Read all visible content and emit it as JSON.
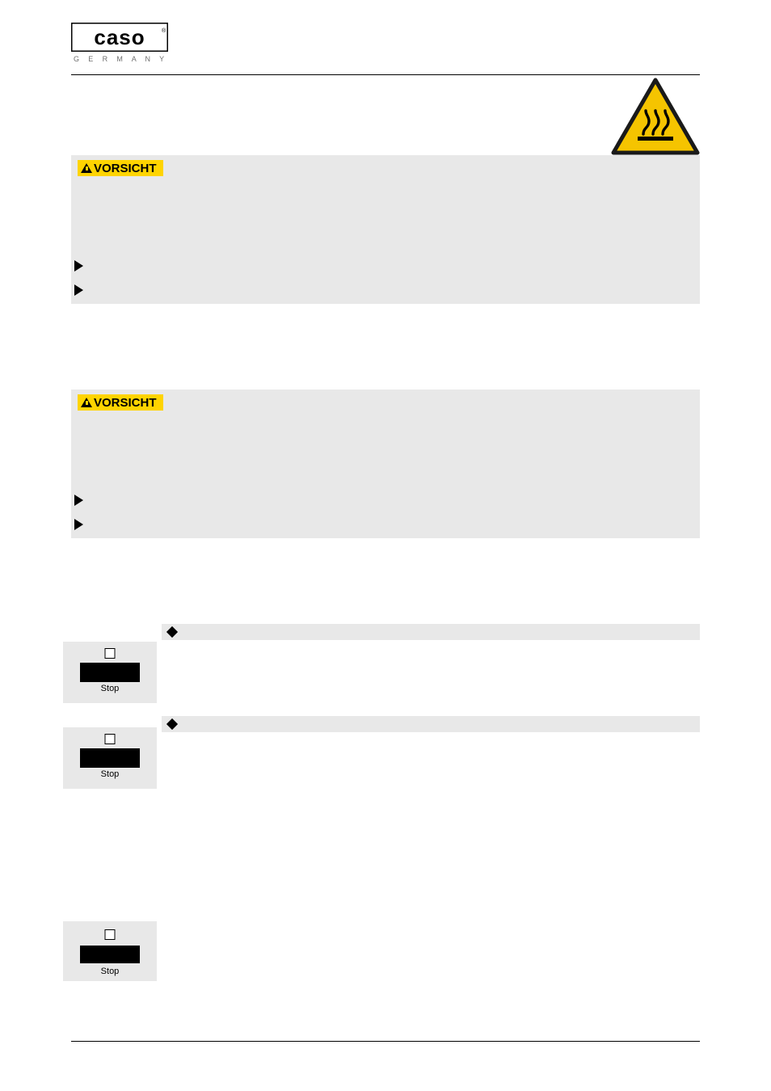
{
  "header": {
    "brand": "CASO",
    "brand_sub": "G E R M A N Y",
    "logo_icon": "caso-logo",
    "hot_surface_icon": "hot-surface-warning-triangle"
  },
  "cautions": [
    {
      "label": "VORSICHT",
      "warning_icon": "warning-triangle-icon",
      "body": "",
      "bullets": [
        "",
        ""
      ]
    },
    {
      "label": "VORSICHT",
      "warning_icon": "warning-triangle-icon",
      "body": "",
      "bullets": [
        "",
        ""
      ]
    }
  ],
  "steps": [
    {
      "panel": {
        "led_icon": "indicator-led",
        "key_label": "Stop"
      },
      "diamond_icon": "diamond-bullet",
      "title": "",
      "body": ""
    },
    {
      "panel": {
        "led_icon": "indicator-led",
        "key_label": "Stop"
      },
      "diamond_icon": "diamond-bullet",
      "title": "",
      "body": ""
    }
  ],
  "final_panel": {
    "led_icon": "indicator-led",
    "key_label": "Stop"
  },
  "section_heading": "",
  "body_blocks": [
    "",
    "",
    ""
  ],
  "footer": {
    "left": "",
    "right": ""
  },
  "colors": {
    "caution_bg": "#e8e8e8",
    "caution_label_bg": "#ffd400",
    "hot_symbol_yellow": "#ffd400",
    "rule": "#000000"
  }
}
